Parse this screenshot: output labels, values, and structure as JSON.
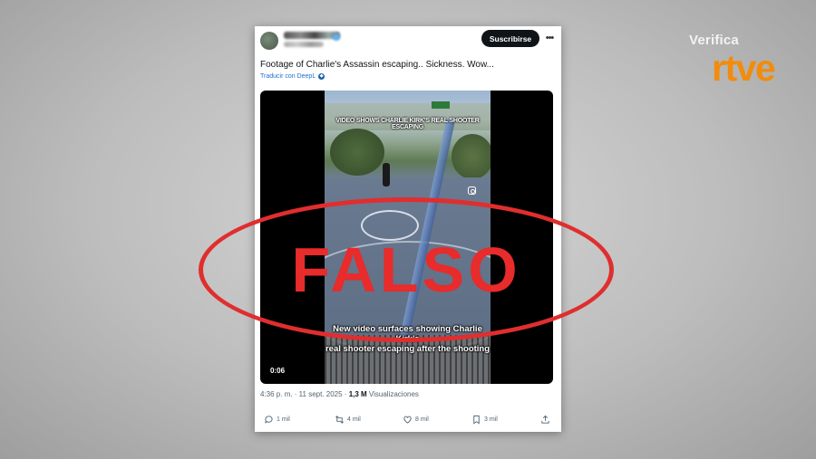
{
  "branding": {
    "verifica": "Verifica",
    "rtve": "rtve",
    "accent_color": "#f28c0c"
  },
  "verdict": {
    "label": "FALSO",
    "color": "#e82b2b"
  },
  "tweet": {
    "subscribe_label": "Suscribirse",
    "more_icon": "more-dots-icon",
    "text": "Footage of Charlie's Assassin escaping..  Sickness.  Wow...",
    "translate_label": "Traducir con DeepL",
    "video": {
      "caption_top": "Video shows Charlie Kirk's real shooter escaping",
      "caption_bottom_line1": "New video surfaces showing Charlie Kirk's",
      "caption_bottom_line2": "real shooter escaping after the shooting",
      "timecode": "0:06"
    },
    "meta": {
      "time_date": "4:36 p. m. · 11 sept. 2025 · ",
      "views_count": "1,3 M",
      "views_label": " Visualizaciones"
    },
    "actions": {
      "replies": "1 mil",
      "reposts": "4 mil",
      "likes": "8 mil",
      "bookmarks": "3 mil"
    }
  }
}
